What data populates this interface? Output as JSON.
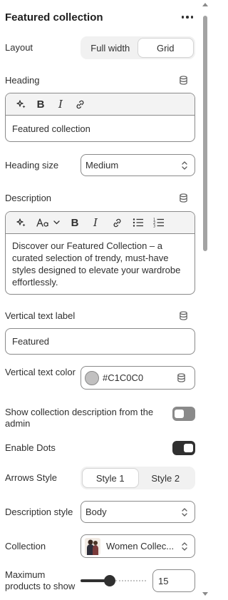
{
  "header": {
    "title": "Featured collection"
  },
  "layout": {
    "label": "Layout",
    "options": [
      "Full width",
      "Grid"
    ],
    "selected": 1
  },
  "heading": {
    "label": "Heading",
    "value": "Featured collection"
  },
  "heading_size": {
    "label": "Heading size",
    "value": "Medium"
  },
  "description": {
    "label": "Description",
    "value": "Discover our Featured Collection – a curated selection of trendy, must-have styles designed to elevate your wardrobe effortlessly."
  },
  "vertical_text_label": {
    "label": "Vertical text label",
    "value": "Featured"
  },
  "vertical_text_color": {
    "label": "Vertical text color",
    "value": "#C1C0C0",
    "swatch": "#C1C0C0"
  },
  "show_collection_desc": {
    "label": "Show collection description from the admin",
    "enabled": false
  },
  "enable_dots": {
    "label": "Enable Dots",
    "enabled": true
  },
  "arrows_style": {
    "label": "Arrows Style",
    "options": [
      "Style 1",
      "Style 2"
    ],
    "selected": 0
  },
  "description_style": {
    "label": "Description style",
    "value": "Body"
  },
  "collection": {
    "label": "Collection",
    "value": "Women Collec..."
  },
  "max_products": {
    "label": "Maximum products to show",
    "value": "15",
    "fraction": 0.45
  },
  "colors": {
    "toggle_off": "#8a8a8a",
    "toggle_on": "#303030",
    "border": "#8a8a8a"
  }
}
